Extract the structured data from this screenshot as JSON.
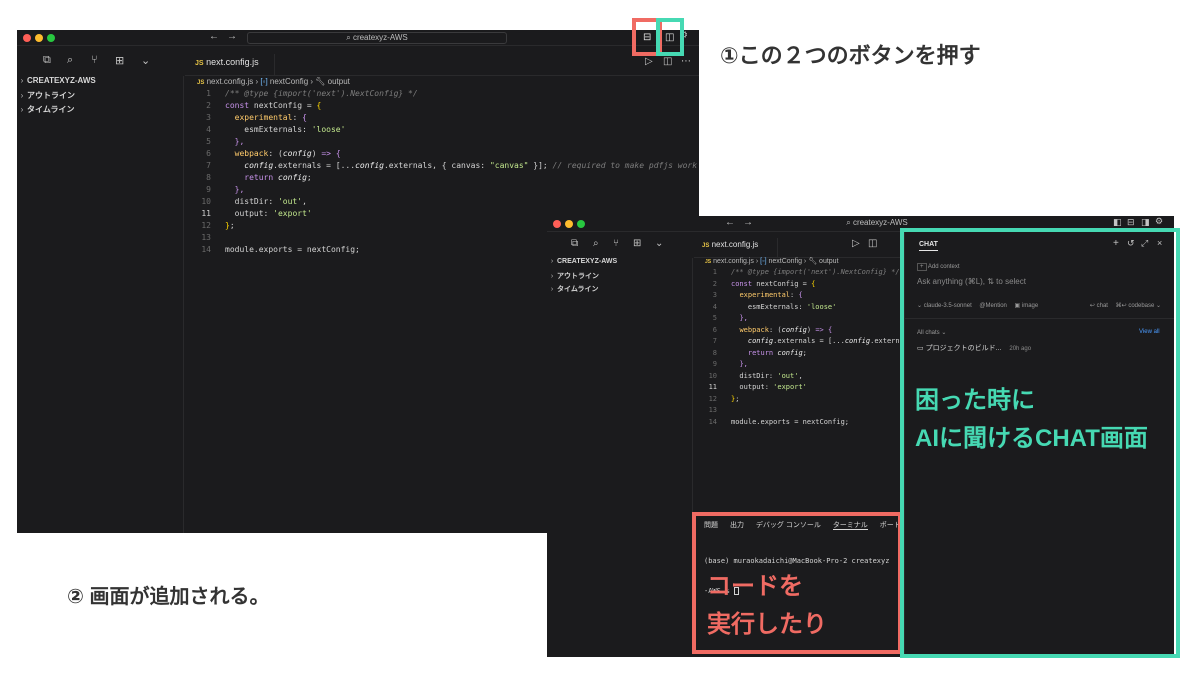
{
  "annotations": {
    "step1": "①この２つのボタンを押す",
    "step2": "② 画面が追加される。"
  },
  "callouts": {
    "chat_line1": "困った時に",
    "chat_line2": "AIに聞けるCHAT画面",
    "terminal_line1": "コードを",
    "terminal_line2": "実行したり"
  },
  "colors": {
    "highlight_red": "#f06b63",
    "highlight_teal": "#46d9b3",
    "editor_bg": "#1b1b1d"
  },
  "editor_back": {
    "title_search": "createxyz-AWS",
    "tab_label": "next.config.js",
    "breadcrumb": [
      "next.config.js",
      "nextConfig",
      "output"
    ],
    "sidebar": [
      {
        "label": "CREATEXYZ-AWS",
        "icon": "chevron-right-icon"
      },
      {
        "label": "アウトライン",
        "icon": "chevron-right-icon"
      },
      {
        "label": "タイムライン",
        "icon": "chevron-right-icon"
      }
    ],
    "comment_tail": " // required to make pdfjs work"
  },
  "editor_front": {
    "title_search": "createxyz-AWS",
    "tab_label": "next.config.js",
    "breadcrumb": [
      "next.config.js",
      "nextConfig",
      "output"
    ],
    "sidebar": [
      {
        "label": "CREATEXYZ-AWS",
        "icon": "chevron-right-icon"
      },
      {
        "label": "アウトライン",
        "icon": "chevron-right-icon"
      },
      {
        "label": "タイムライン",
        "icon": "chevron-right-icon"
      }
    ],
    "panel_tabs": [
      "問題",
      "出力",
      "デバッグ コンソール",
      "ターミナル",
      "ポート"
    ],
    "terminal_lines": [
      "(base) muraokadaichi@MacBook-Pro-2 createxyz",
      "-AWS % "
    ],
    "chat": {
      "title": "CHAT",
      "add_context": "Add context",
      "placeholder": "Ask anything (⌘L), ⇅ to select",
      "model": "claude-3.5-sonnet",
      "mention": "Mention",
      "image": "image",
      "chat_btn": "chat",
      "codebase_btn": "codebase",
      "all_chats": "All chats",
      "view_all": "View all",
      "history_item": "プロジェクトのビルド...",
      "history_time": "20h ago"
    }
  },
  "code_lines": [
    {
      "n": "1",
      "tokens": [
        [
          "comment",
          "/** @type {import('next').NextConfig} */"
        ]
      ]
    },
    {
      "n": "2",
      "tokens": [
        [
          "kw",
          "const"
        ],
        [
          "plain",
          " nextConfig "
        ],
        [
          "plain",
          "= "
        ],
        [
          "brace",
          "{"
        ]
      ]
    },
    {
      "n": "3",
      "tokens": [
        [
          "plain",
          "  "
        ],
        [
          "prop",
          "experimental"
        ],
        [
          "plain",
          ": "
        ],
        [
          "kw",
          "{"
        ]
      ]
    },
    {
      "n": "4",
      "tokens": [
        [
          "plain",
          "    esmExternals: "
        ],
        [
          "str",
          "'loose'"
        ]
      ]
    },
    {
      "n": "5",
      "tokens": [
        [
          "plain",
          "  "
        ],
        [
          "kw",
          "},"
        ]
      ]
    },
    {
      "n": "6",
      "tokens": [
        [
          "plain",
          "  "
        ],
        [
          "prop",
          "webpack"
        ],
        [
          "plain",
          ": ("
        ],
        [
          "var",
          "config"
        ],
        [
          "plain",
          ") "
        ],
        [
          "kw",
          "=>"
        ],
        [
          "plain",
          " "
        ],
        [
          "kw",
          "{"
        ]
      ]
    },
    {
      "n": "7",
      "tokens": [
        [
          "plain",
          "    "
        ],
        [
          "var",
          "config"
        ],
        [
          "plain",
          ".externals = [..."
        ],
        [
          "var",
          "config"
        ],
        [
          "plain",
          ".externals, { canvas: "
        ],
        [
          "str",
          "\"canvas\""
        ],
        [
          "plain",
          " }];"
        ]
      ]
    },
    {
      "n": "8",
      "tokens": [
        [
          "plain",
          "    "
        ],
        [
          "kw",
          "return"
        ],
        [
          "plain",
          " "
        ],
        [
          "var",
          "config"
        ],
        [
          "plain",
          ";"
        ]
      ]
    },
    {
      "n": "9",
      "tokens": [
        [
          "plain",
          "  "
        ],
        [
          "kw",
          "},"
        ]
      ]
    },
    {
      "n": "10",
      "tokens": [
        [
          "plain",
          "  distDir: "
        ],
        [
          "str",
          "'out'"
        ],
        [
          "plain",
          ","
        ]
      ]
    },
    {
      "n": "11",
      "tokens": [
        [
          "plain",
          "  output: "
        ],
        [
          "str",
          "'export'"
        ]
      ]
    },
    {
      "n": "12",
      "tokens": [
        [
          "brace",
          "}"
        ],
        [
          "plain",
          ";"
        ]
      ]
    },
    {
      "n": "13",
      "tokens": []
    },
    {
      "n": "14",
      "tokens": [
        [
          "plain",
          "module.exports = nextConfig;"
        ]
      ]
    }
  ]
}
